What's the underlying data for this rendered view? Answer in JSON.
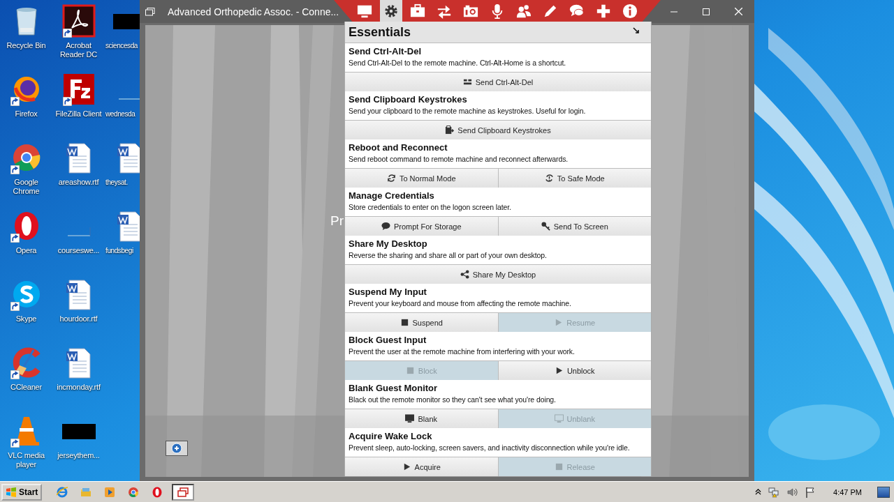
{
  "desktop": {
    "columns": [
      {
        "icons": [
          {
            "label": "Recycle Bin",
            "shortcut": false
          },
          {
            "label": "Firefox",
            "shortcut": true
          },
          {
            "label": "Google Chrome",
            "shortcut": true
          },
          {
            "label": "Opera",
            "shortcut": true
          },
          {
            "label": "Skype",
            "shortcut": true
          },
          {
            "label": "CCleaner",
            "shortcut": true
          },
          {
            "label": "VLC media player",
            "shortcut": true
          }
        ]
      },
      {
        "icons": [
          {
            "label": "Acrobat Reader DC",
            "shortcut": true
          },
          {
            "label": "FileZilla Client",
            "shortcut": true
          },
          {
            "label": "areashow.rtf",
            "shortcut": false
          },
          {
            "label": "courseswe...",
            "shortcut": false
          },
          {
            "label": "hourdoor.rtf",
            "shortcut": false
          },
          {
            "label": "incmonday.rtf",
            "shortcut": false
          },
          {
            "label": "jerseythem...",
            "shortcut": false
          }
        ]
      },
      {
        "icons": [
          {
            "label": "sciencesda",
            "shortcut": false
          },
          {
            "label": "wednesda",
            "shortcut": false
          },
          {
            "label": "theysat.",
            "shortcut": false
          },
          {
            "label": "fundsbegi",
            "shortcut": false
          }
        ]
      }
    ]
  },
  "window": {
    "title": "Advanced Orthopedic Assoc. - Conne...",
    "remote_text": "Pr"
  },
  "toolbar": {
    "buttons": [
      {
        "selected": false
      },
      {
        "selected": true
      },
      {
        "selected": false
      },
      {
        "selected": false
      },
      {
        "selected": false
      },
      {
        "selected": false
      },
      {
        "selected": false
      },
      {
        "selected": false
      },
      {
        "selected": false
      },
      {
        "selected": false
      },
      {
        "selected": false
      }
    ]
  },
  "panel": {
    "title": "Essentials",
    "sections": [
      {
        "title": "Send Ctrl-Alt-Del",
        "description": "Send Ctrl-Alt-Del to the remote machine. Ctrl-Alt-Home is a shortcut.",
        "buttons": [
          {
            "label": "Send Ctrl-Alt-Del",
            "disabled": false
          }
        ]
      },
      {
        "title": "Send Clipboard Keystrokes",
        "description": "Send your clipboard to the remote machine as keystrokes. Useful for login.",
        "buttons": [
          {
            "label": "Send Clipboard Keystrokes",
            "disabled": false
          }
        ]
      },
      {
        "title": "Reboot and Reconnect",
        "description": "Send reboot command to remote machine and reconnect afterwards.",
        "buttons": [
          {
            "label": "To Normal Mode",
            "disabled": false
          },
          {
            "label": "To Safe Mode",
            "disabled": false
          }
        ]
      },
      {
        "title": "Manage Credentials",
        "description": "Store credentials to enter on the logon screen later.",
        "buttons": [
          {
            "label": "Prompt For Storage",
            "disabled": false
          },
          {
            "label": "Send To Screen",
            "disabled": false
          }
        ]
      },
      {
        "title": "Share My Desktop",
        "description": "Reverse the sharing and share all or part of your own desktop.",
        "buttons": [
          {
            "label": "Share My Desktop",
            "disabled": false
          }
        ]
      },
      {
        "title": "Suspend My Input",
        "description": "Prevent your keyboard and mouse from affecting the remote machine.",
        "buttons": [
          {
            "label": "Suspend",
            "disabled": false
          },
          {
            "label": "Resume",
            "disabled": true
          }
        ]
      },
      {
        "title": "Block Guest Input",
        "description": "Prevent the user at the remote machine from interfering with your work.",
        "buttons": [
          {
            "label": "Block",
            "disabled": true
          },
          {
            "label": "Unblock",
            "disabled": false
          }
        ]
      },
      {
        "title": "Blank Guest Monitor",
        "description": "Black out the remote monitor so they can't see what you're doing.",
        "buttons": [
          {
            "label": "Blank",
            "disabled": false
          },
          {
            "label": "Unblank",
            "disabled": true
          }
        ]
      },
      {
        "title": "Acquire Wake Lock",
        "description": "Prevent sleep, auto-locking, screen savers, and inactivity disconnection while you're idle.",
        "buttons": [
          {
            "label": "Acquire",
            "disabled": false
          },
          {
            "label": "Release",
            "disabled": true
          }
        ]
      }
    ]
  },
  "taskbar": {
    "start": "Start",
    "apps": [
      {
        "selected": false
      },
      {
        "selected": false
      },
      {
        "selected": false
      },
      {
        "selected": false
      },
      {
        "selected": false
      },
      {
        "selected": true
      }
    ],
    "clock": "4:47 PM"
  }
}
